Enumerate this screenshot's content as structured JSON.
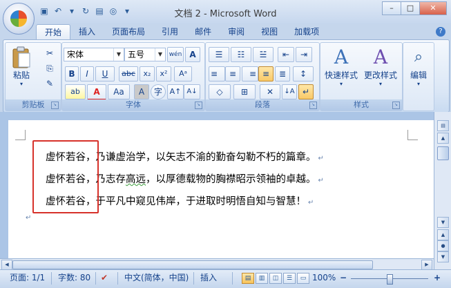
{
  "window": {
    "title": "文档 2 - Microsoft Word",
    "controls": {
      "minimize": "–",
      "restore": "□",
      "close": "✕"
    }
  },
  "qat": {
    "items": [
      "save-icon",
      "undo-icon",
      "redo-icon",
      "open-icon",
      "print-preview-icon",
      "customize-icon"
    ],
    "glyphs": [
      "▣",
      "↶",
      "↻",
      "▤",
      "◎",
      "▾"
    ]
  },
  "ribbon": {
    "tabs": [
      "开始",
      "插入",
      "页面布局",
      "引用",
      "邮件",
      "审阅",
      "视图",
      "加载项"
    ],
    "active_tab": "开始",
    "help_glyph": "?",
    "groups": {
      "clipboard": {
        "label": "剪贴板",
        "paste_label": "粘贴",
        "paste_arrow": "▾",
        "cut_glyph": "✂",
        "copy_glyph": "⎘",
        "format_painter_glyph": "✎"
      },
      "font": {
        "label": "字体",
        "font_name": "宋体",
        "font_size": "五号",
        "grow_glyph": "A",
        "phonetic_glyph": "wén",
        "border_glyph": "A",
        "bold": "B",
        "italic": "I",
        "underline": "U",
        "strike": "abc",
        "subscript": "x₂",
        "superscript": "x²",
        "clear_format_glyph": "Aᵃ",
        "highlight_glyph": "ab",
        "font_color_glyph": "A",
        "change_case_glyph": "Aa",
        "shading_glyph": "A",
        "enclose_glyph": "字",
        "grow_font_glyph": "A↑",
        "shrink_font_glyph": "A↓"
      },
      "paragraph": {
        "label": "段落",
        "bullets_glyph": "☰",
        "numbering_glyph": "☷",
        "multilevel_glyph": "☱",
        "dec_indent_glyph": "⇤",
        "inc_indent_glyph": "⇥",
        "align_left": "≡",
        "align_center": "≡",
        "align_right": "≡",
        "justify": "≡",
        "distributed": "≣",
        "line_spacing": "↕",
        "shading_glyph": "◇",
        "borders_glyph": "⊞",
        "chinese_layout_glyph": "✕",
        "sort_glyph": "↓A",
        "show_marks_glyph": "↵"
      },
      "styles": {
        "label": "样式",
        "quick_styles": "快速样式",
        "change_styles": "更改样式",
        "quick_glyph": "A",
        "change_glyph": "A"
      },
      "editing": {
        "label": "编辑",
        "glyph": "⌕"
      }
    }
  },
  "document": {
    "paragraphs": [
      {
        "lead": "虚怀若谷，",
        "rest": "乃谦虚治学，以矢志不渝的勤奋勾勒不朽的篇章。",
        "mark": "↵"
      },
      {
        "lead": "虚怀若谷，",
        "rest_a": "乃志存",
        "rest_b": "高远",
        "rest_c": "，以厚德载物的胸襟昭示领袖的卓越。",
        "mark": "↵"
      },
      {
        "lead": "虚怀若谷，",
        "rest": "于平凡中窥见伟岸，于进取时明悟自知与智慧！",
        "mark": "↵"
      }
    ],
    "empty_mark": "↵"
  },
  "statusbar": {
    "page": "页面: 1/1",
    "words": "字数: 80",
    "language": "中文(简体，中国)",
    "mode": "插入",
    "zoom": "100%",
    "zoom_minus": "−",
    "zoom_plus": "+",
    "zoom_level_percent": 100
  },
  "scroll": {
    "up": "▲",
    "down": "▼",
    "left": "◀",
    "right": "▶",
    "ruler_glyph": "▤",
    "prev": "▲",
    "browse": "●",
    "next": "▼"
  }
}
